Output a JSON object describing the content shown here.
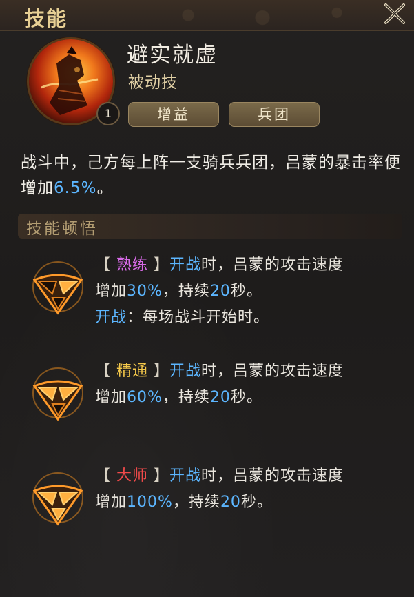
{
  "window": {
    "title": "技能"
  },
  "skill": {
    "name": "避实就虚",
    "type": "被动技",
    "level": "1",
    "tags": [
      "增益",
      "兵团"
    ],
    "description": {
      "prefix": "战斗中，己方每上阵一支骑兵兵团，吕蒙的暴击率便增加",
      "value": "6.5%",
      "suffix": "。"
    }
  },
  "insight": {
    "title": "技能顿悟",
    "ranks": [
      {
        "rank_label": "熟练",
        "trigger": "开战",
        "line1_rest": "时，吕蒙的攻击速度",
        "line2_prefix": "增加",
        "bonus": "30%",
        "line2_mid": "，持续",
        "duration": "20",
        "line2_suffix": "秒。",
        "note_keyword": "开战",
        "note_text": "：每场战斗开始时。"
      },
      {
        "rank_label": "精通",
        "trigger": "开战",
        "line1_rest": "时，吕蒙的攻击速度",
        "line2_prefix": "增加",
        "bonus": "60%",
        "line2_mid": "，持续",
        "duration": "20",
        "line2_suffix": "秒。"
      },
      {
        "rank_label": "大师",
        "trigger": "开战",
        "line1_rest": "时，吕蒙的攻击速度",
        "line2_prefix": "增加",
        "bonus": "100%",
        "line2_mid": "，持续",
        "duration": "20",
        "line2_suffix": "秒。"
      }
    ]
  },
  "colors": {
    "highlight": "#5cb6ff",
    "rank_familiar": "#d66ae6",
    "rank_proficient": "#f3c74a",
    "rank_master": "#f24a4a",
    "title_gold": "#e7cf94"
  },
  "icons": {
    "close": "close-icon",
    "avatar": "skill-portrait-icon",
    "emblem": "insight-emblem-icon"
  }
}
